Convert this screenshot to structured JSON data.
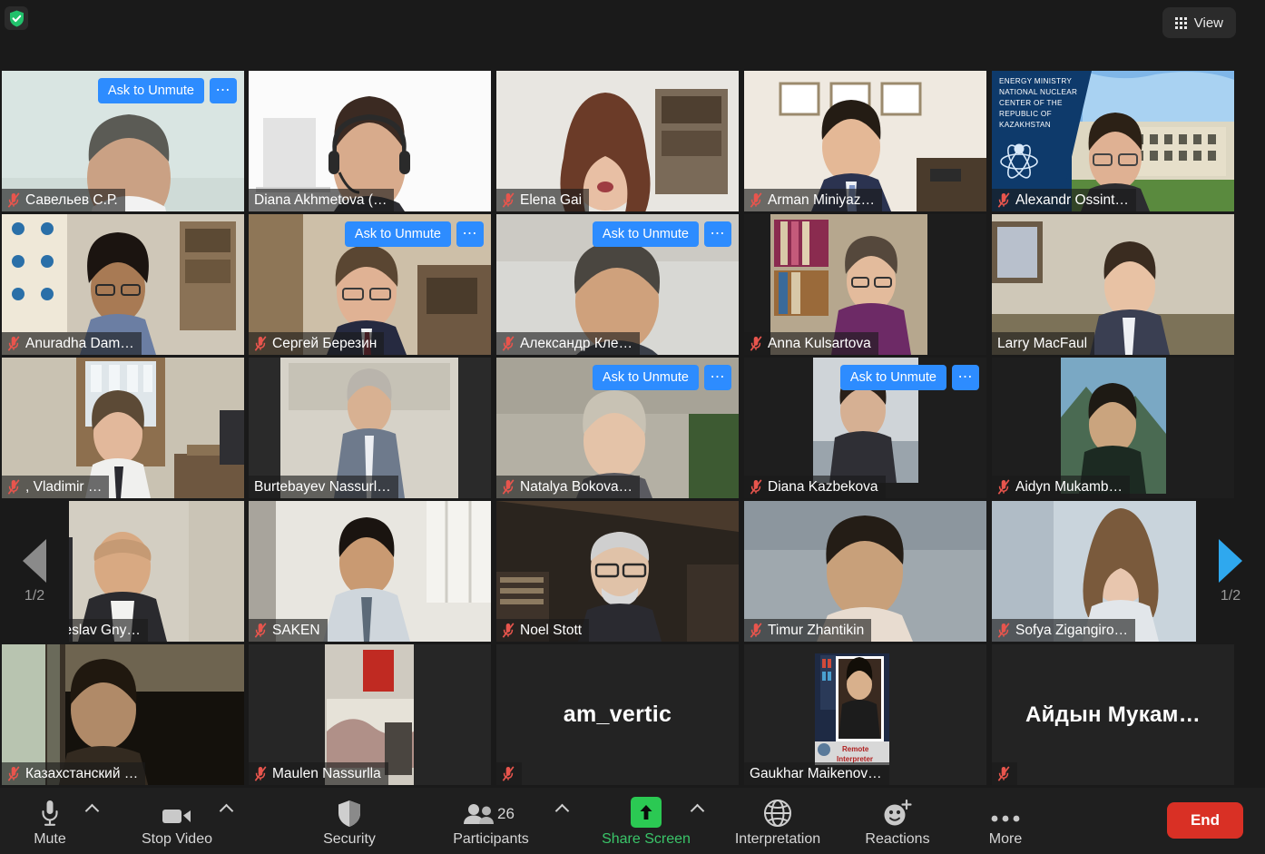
{
  "topbar": {
    "shield_icon": "encryption-shield-icon",
    "view_button": {
      "label": "View",
      "icon": "grid-view-icon"
    }
  },
  "gallery": {
    "pager_left": {
      "label": "1/2",
      "icon": "chevron-left-icon",
      "state": "disabled"
    },
    "pager_right": {
      "label": "1/2",
      "icon": "chevron-right-icon",
      "state": "enabled"
    },
    "ask_to_unmute_label": "Ask to Unmute",
    "more_label": "⋯",
    "virtual_bg_text": "ENERGY MINISTRY NATIONAL NUCLEAR CENTER OF THE REPUBLIC OF KAZAKHSTAN",
    "interpreter_badge": "Remote Interpreter",
    "rows": [
      [
        {
          "name": "Савельев С.Р.",
          "muted": true,
          "ask_to_unmute": true,
          "active": false
        },
        {
          "name": "Diana Akhmetova (…",
          "muted": false,
          "ask_to_unmute": false,
          "active": true
        },
        {
          "name": "Elena Gai",
          "muted": true,
          "ask_to_unmute": false,
          "active": false
        },
        {
          "name": "Arman Miniyaz…",
          "muted": true,
          "ask_to_unmute": false,
          "active": false
        },
        {
          "name": "Alexandr Ossint…",
          "muted": true,
          "ask_to_unmute": false,
          "active": false
        }
      ],
      [
        {
          "name": "Anuradha Dam…",
          "muted": true,
          "ask_to_unmute": false,
          "active": false
        },
        {
          "name": "Сергей Березин",
          "muted": true,
          "ask_to_unmute": true,
          "active": false
        },
        {
          "name": "Александр Кле…",
          "muted": true,
          "ask_to_unmute": true,
          "active": false
        },
        {
          "name": "Anna Kulsartova",
          "muted": true,
          "ask_to_unmute": false,
          "active": false
        },
        {
          "name": "Larry MacFaul",
          "muted": false,
          "ask_to_unmute": false,
          "active": false
        }
      ],
      [
        {
          "name": ", Vladimir …",
          "muted": true,
          "ask_to_unmute": false,
          "active": false
        },
        {
          "name": "Burtebayev Nassurl…",
          "muted": false,
          "ask_to_unmute": false,
          "active": false
        },
        {
          "name": "Natalya Bokova…",
          "muted": true,
          "ask_to_unmute": true,
          "active": false
        },
        {
          "name": "Diana Kazbekova",
          "muted": true,
          "ask_to_unmute": true,
          "active": false
        },
        {
          "name": "Aidyn Mukamb…",
          "muted": true,
          "ask_to_unmute": false,
          "active": false
        }
      ],
      [
        {
          "name": "Vyacheslav Gny…",
          "muted": true,
          "ask_to_unmute": false,
          "active": false
        },
        {
          "name": "SAKEN",
          "muted": true,
          "ask_to_unmute": false,
          "active": false
        },
        {
          "name": "Noel Stott",
          "muted": true,
          "ask_to_unmute": false,
          "active": false
        },
        {
          "name": "Timur Zhantikin",
          "muted": true,
          "ask_to_unmute": false,
          "active": false
        },
        {
          "name": "Sofya Zigangiro…",
          "muted": true,
          "ask_to_unmute": false,
          "active": false
        }
      ],
      [
        {
          "name": "Казахстанский …",
          "muted": true,
          "ask_to_unmute": false,
          "active": false
        },
        {
          "name": "Maulen Nassurlla",
          "muted": true,
          "ask_to_unmute": false,
          "active": false
        },
        {
          "name": "",
          "display_name": "am_vertic",
          "muted": true,
          "ask_to_unmute": false,
          "active": false
        },
        {
          "name": "Gaukhar Maikenov…",
          "muted": false,
          "ask_to_unmute": false,
          "active": false
        },
        {
          "name": "",
          "display_name": "Айдын  Мукам…",
          "muted": true,
          "ask_to_unmute": false,
          "active": false
        }
      ]
    ]
  },
  "toolbar": {
    "mute": {
      "label": "Mute",
      "icon": "microphone-icon",
      "has_caret": true
    },
    "video": {
      "label": "Stop Video",
      "icon": "video-camera-icon",
      "has_caret": true
    },
    "security": {
      "label": "Security",
      "icon": "shield-icon",
      "has_caret": false
    },
    "participants": {
      "label": "Participants",
      "icon": "people-icon",
      "count": "26",
      "has_caret": true
    },
    "share": {
      "label": "Share Screen",
      "icon": "share-up-arrow-icon",
      "has_caret": true
    },
    "interpretation": {
      "label": "Interpretation",
      "icon": "globe-icon",
      "has_caret": false
    },
    "reactions": {
      "label": "Reactions",
      "icon": "smiley-plus-icon",
      "has_caret": false
    },
    "more": {
      "label": "More",
      "icon": "ellipsis-icon",
      "has_caret": false
    },
    "end": {
      "label": "End"
    }
  },
  "colors": {
    "accent_blue": "#2d8cff",
    "active_speaker": "#e8f54a",
    "end_red": "#d93025",
    "share_green": "#2bc953",
    "mute_red": "#e8554d",
    "pager_active": "#2fa8ee"
  }
}
